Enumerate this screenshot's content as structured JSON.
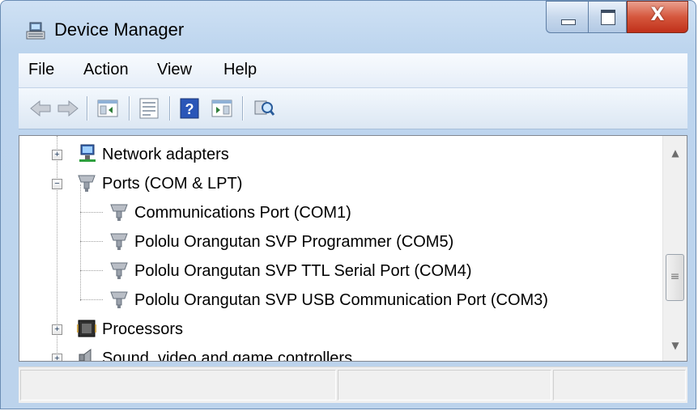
{
  "window": {
    "title": "Device Manager",
    "close_symbol": "X",
    "title_icon": "device-manager-icon"
  },
  "menu": {
    "items": [
      "File",
      "Action",
      "View",
      "Help"
    ]
  },
  "toolbar": {
    "buttons": [
      "back-arrow-icon",
      "forward-arrow-icon",
      "show-hide-console-tree-icon",
      "properties-icon",
      "help-icon",
      "show-action-pane-icon",
      "scan-hardware-changes-icon"
    ]
  },
  "tree": {
    "nodes": [
      {
        "label": "Network adapters",
        "icon": "network-adapter-icon",
        "expanded": false
      },
      {
        "label": "Ports (COM & LPT)",
        "icon": "port-connector-icon",
        "expanded": true
      },
      {
        "label": "Communications Port (COM1)",
        "icon": "port-connector-icon"
      },
      {
        "label": "Pololu Orangutan SVP Programmer (COM5)",
        "icon": "port-connector-icon"
      },
      {
        "label": "Pololu Orangutan SVP TTL Serial Port (COM4)",
        "icon": "port-connector-icon"
      },
      {
        "label": "Pololu Orangutan SVP USB Communication Port (COM3)",
        "icon": "port-connector-icon"
      },
      {
        "label": "Processors",
        "icon": "processor-chip-icon",
        "expanded": false
      },
      {
        "label": "Sound, video and game controllers",
        "icon": "speaker-icon",
        "expanded": false
      }
    ]
  },
  "scrollbar": {
    "grip": "≡",
    "up": "▲",
    "down": "▼"
  },
  "colors": {
    "titlebar": "#bcd3ec",
    "close_button": "#c7432a"
  }
}
